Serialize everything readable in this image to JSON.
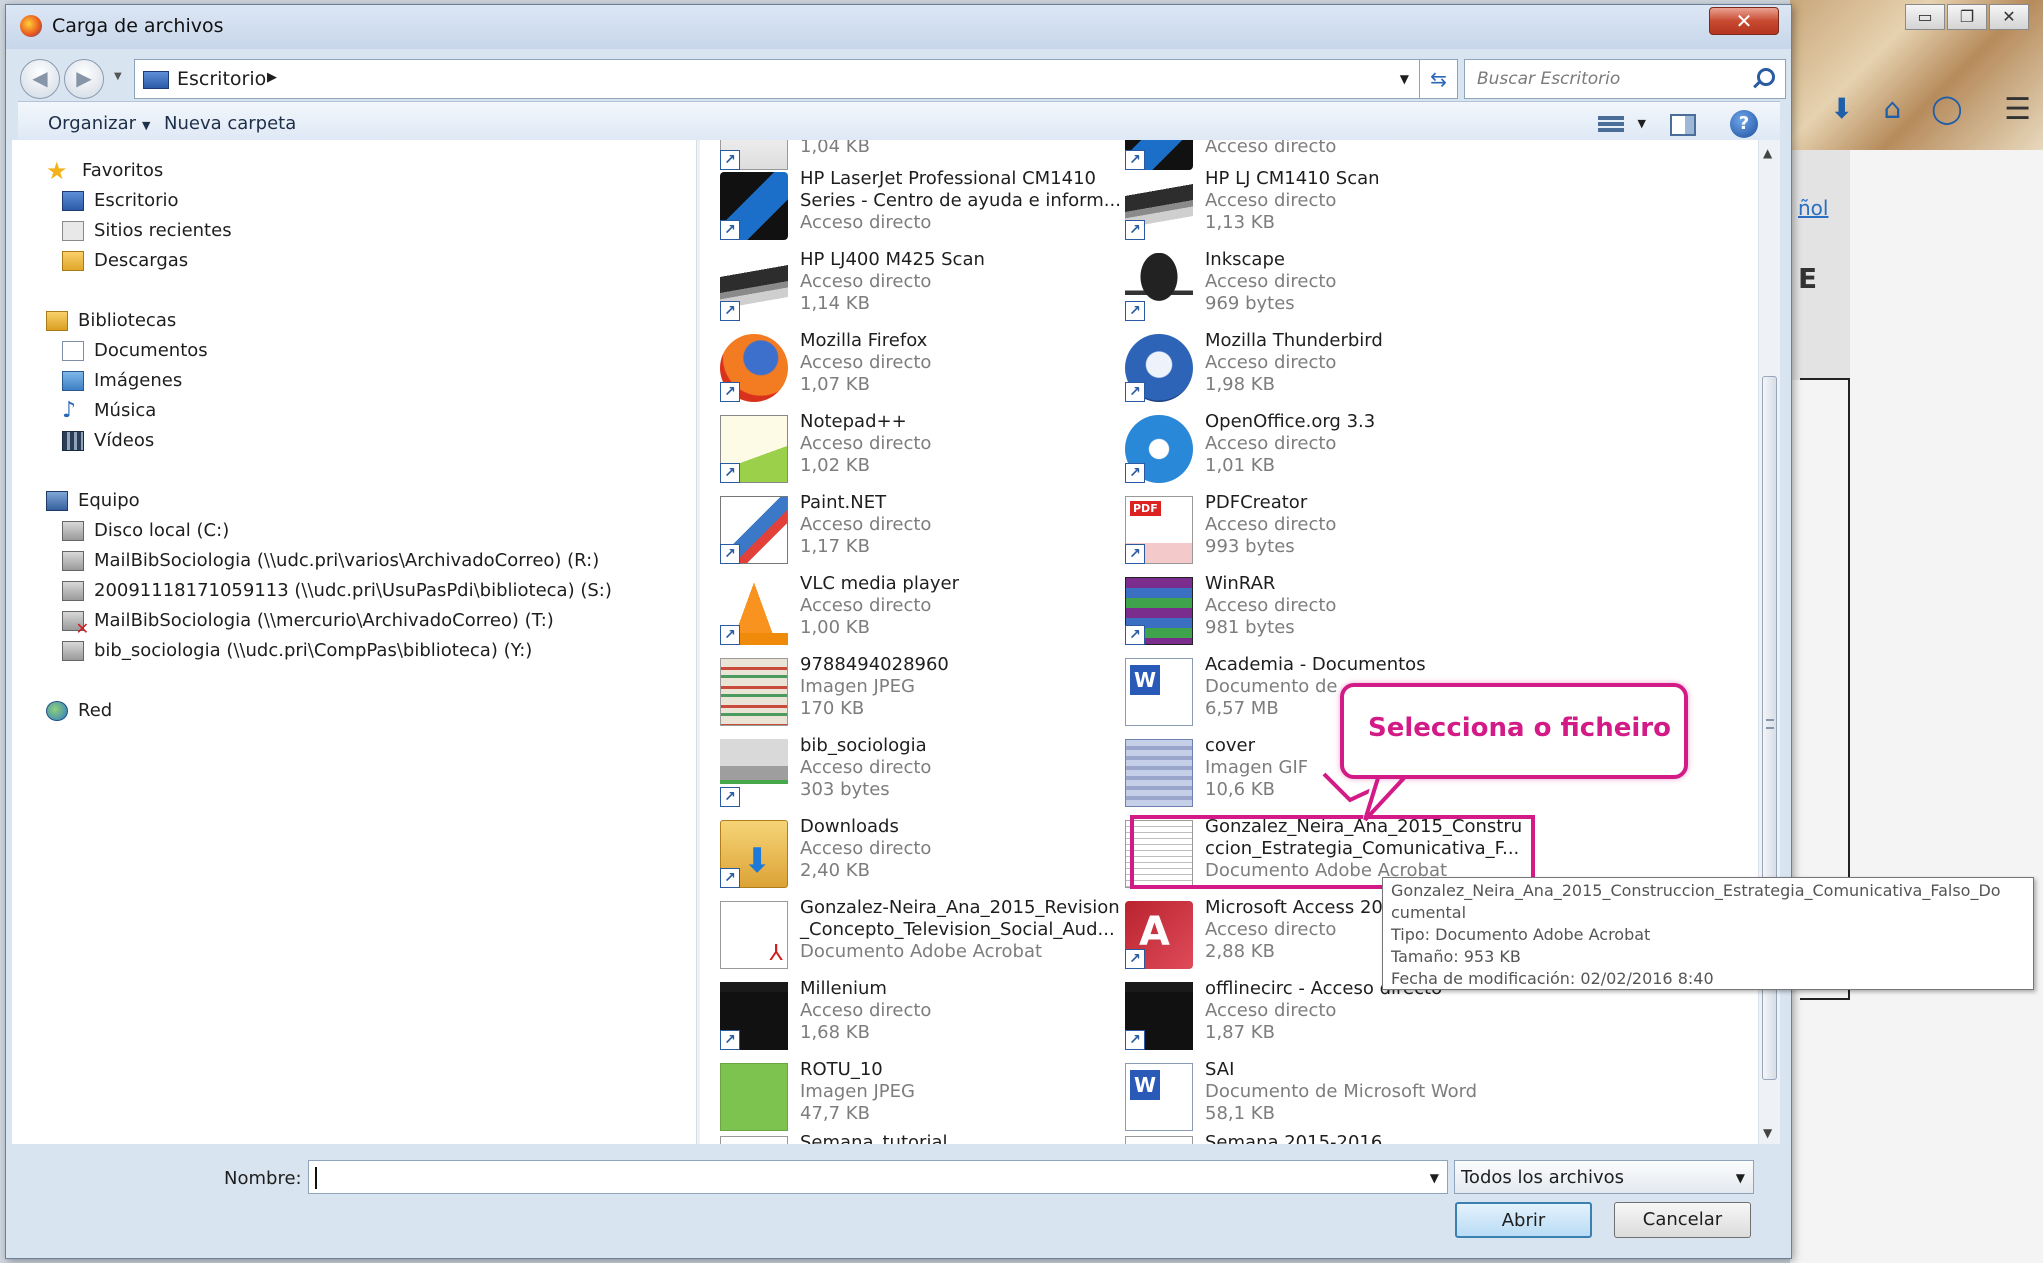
{
  "window": {
    "title": "Carga de archivos",
    "close_label": "✕"
  },
  "address": {
    "location": "Escritorio",
    "search_placeholder": "Buscar Escritorio"
  },
  "toolbar": {
    "organize": "Organizar",
    "new_folder": "Nueva carpeta"
  },
  "nav": {
    "favorites": {
      "title": "Favoritos",
      "items": [
        "Escritorio",
        "Sitios recientes",
        "Descargas"
      ]
    },
    "libraries": {
      "title": "Bibliotecas",
      "items": [
        "Documentos",
        "Imágenes",
        "Música",
        "Vídeos"
      ]
    },
    "computer": {
      "title": "Equipo",
      "items": [
        "Disco local (C:)",
        "MailBibSociologia (\\\\udc.pri\\varios\\ArchivadoCorreo) (R:)",
        "20091118171059113 (\\\\udc.pri\\UsuPasPdi\\biblioteca) (S:)",
        "MailBibSociologia (\\\\mercurio\\ArchivadoCorreo) (T:)",
        "bib_sociologia (\\\\udc.pri\\CompPas\\biblioteca) (Y:)"
      ]
    },
    "network": {
      "title": "Red"
    }
  },
  "files": {
    "top_left_partial": {
      "size": "1,04 KB"
    },
    "top_right_partial": {
      "type": "Acceso directo"
    },
    "left": [
      {
        "name": "HP LaserJet Professional CM1410",
        "name2": "Series - Centro de ayuda e inform...",
        "type": "Acceso directo",
        "size": "",
        "icon": "hp-icon"
      },
      {
        "name": "HP LJ400 M425 Scan",
        "type": "Acceso directo",
        "size": "1,14 KB",
        "icon": "scanner-icon"
      },
      {
        "name": "Mozilla Firefox",
        "type": "Acceso directo",
        "size": "1,07 KB",
        "icon": "firefox-icon"
      },
      {
        "name": "Notepad++",
        "type": "Acceso directo",
        "size": "1,02 KB",
        "icon": "notepad-icon"
      },
      {
        "name": "Paint.NET",
        "type": "Acceso directo",
        "size": "1,17 KB",
        "icon": "paint-icon"
      },
      {
        "name": "VLC media player",
        "type": "Acceso directo",
        "size": "1,00 KB",
        "icon": "vlc-icon"
      },
      {
        "name": "9788494028960",
        "type": "Imagen JPEG",
        "size": "170 KB",
        "icon": "jpeg-icon"
      },
      {
        "name": "bib_sociologia",
        "type": "Acceso directo",
        "size": "303 bytes",
        "icon": "network-drive-icon"
      },
      {
        "name": "Downloads",
        "type": "Acceso directo",
        "size": "2,40 KB",
        "icon": "folder-icon"
      },
      {
        "name": "Gonzalez-Neira_Ana_2015_Revision",
        "name2": "_Concepto_Television_Social_Aud...",
        "type": "Documento Adobe Acrobat",
        "size": "",
        "icon": "pdf-icon"
      },
      {
        "name": "Millenium",
        "type": "Acceso directo",
        "size": "1,68 KB",
        "icon": "millenium-icon"
      },
      {
        "name": "ROTU_10",
        "type": "Imagen JPEG",
        "size": "47,7 KB",
        "icon": "jpeg-icon"
      }
    ],
    "right": [
      {
        "name": "HP LJ CM1410 Scan",
        "type": "Acceso directo",
        "size": "1,13 KB",
        "icon": "scanner-icon"
      },
      {
        "name": "Inkscape",
        "type": "Acceso directo",
        "size": "969 bytes",
        "icon": "inkscape-icon"
      },
      {
        "name": "Mozilla Thunderbird",
        "type": "Acceso directo",
        "size": "1,98 KB",
        "icon": "thunderbird-icon"
      },
      {
        "name": "OpenOffice.org 3.3",
        "type": "Acceso directo",
        "size": "1,01 KB",
        "icon": "openoffice-icon"
      },
      {
        "name": "PDFCreator",
        "type": "Acceso directo",
        "size": "993 bytes",
        "icon": "pdfcreator-icon"
      },
      {
        "name": "WinRAR",
        "type": "Acceso directo",
        "size": "981 bytes",
        "icon": "winrar-icon"
      },
      {
        "name": "Academia - Documentos",
        "type": "Documento de",
        "size": "6,57 MB",
        "icon": "word-icon"
      },
      {
        "name": "cover",
        "type": "Imagen GIF",
        "size": "10,6 KB",
        "icon": "gif-icon"
      },
      {
        "name": "Gonzalez_Neira_Ana_2015_Constru",
        "name2": "ccion_Estrategia_Comunicativa_F...",
        "type": "Documento Adobe Acrobat",
        "size": "",
        "icon": "pdf-icon"
      },
      {
        "name": "Microsoft Access 20",
        "type": "Acceso directo",
        "size": "2,88 KB",
        "icon": "access-icon"
      },
      {
        "name": "offlinecirc - Acceso directo",
        "type": "Acceso directo",
        "size": "1,87 KB",
        "icon": "millenium-icon"
      },
      {
        "name": "SAI",
        "type": "Documento de Microsoft Word",
        "size": "58,1 KB",
        "icon": "word-icon"
      }
    ],
    "bottom_left_partial": {
      "name": "Semana_tutorial..."
    },
    "bottom_right_partial": {
      "name": "Semana 2015-2016"
    }
  },
  "tooltip": {
    "line1": "Gonzalez_Neira_Ana_2015_Construccion_Estrategia_Comunicativa_Falso_Do",
    "line2": "cumental",
    "type": "Tipo: Documento Adobe Acrobat",
    "size": "Tamaño: 953 KB",
    "date": "Fecha de modificación: 02/02/2016 8:40"
  },
  "callout": {
    "text": "Selecciona o ficheiro",
    "color": "#d21b86"
  },
  "bottom": {
    "name_label": "Nombre:",
    "name_value": "",
    "filter_value": "Todos los archivos",
    "open_label": "Abrir",
    "cancel_label": "Cancelar"
  },
  "background": {
    "link_text": "ñol",
    "letter": "E"
  }
}
